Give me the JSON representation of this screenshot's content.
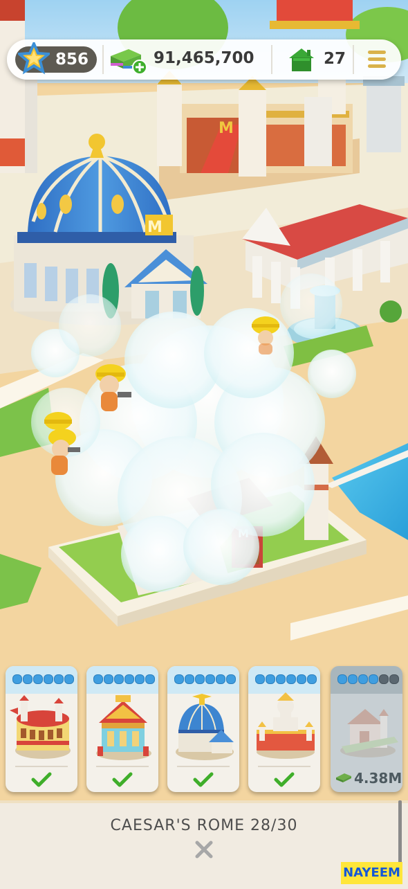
{
  "hud": {
    "level": "856",
    "cash": "91,465,700",
    "houses": "27",
    "icons": {
      "level": "star-badge-icon",
      "cash": "cash-stack-icon",
      "add_cash": "plus-icon",
      "houses": "house-icon",
      "menu": "hamburger-menu-icon"
    }
  },
  "scene": {
    "description_icons": [
      "dome-building",
      "monopoly-pavilion",
      "temple",
      "fountain",
      "construction-workers",
      "smoke-cloud",
      "house-under-construction"
    ]
  },
  "cards": [
    {
      "name": "colosseum",
      "stars_filled": 6,
      "stars_total": 6,
      "status": "done",
      "icon": "check-icon"
    },
    {
      "name": "palace",
      "stars_filled": 6,
      "stars_total": 6,
      "status": "done",
      "icon": "check-icon"
    },
    {
      "name": "domed-theatre",
      "stars_filled": 6,
      "stars_total": 6,
      "status": "done",
      "icon": "check-icon"
    },
    {
      "name": "statue-monument",
      "stars_filled": 6,
      "stars_total": 6,
      "status": "done",
      "icon": "check-icon"
    },
    {
      "name": "villa",
      "stars_filled": 4,
      "stars_total": 6,
      "status": "locked",
      "price": "4.38M",
      "icon": "cash-icon"
    }
  ],
  "bottom": {
    "title": "CAESAR'S ROME 28/30",
    "close_icon": "close-x-icon"
  },
  "watermark": "NAYEEM",
  "colors": {
    "accent_blue": "#3f9ee0",
    "check_green": "#3fae2a",
    "gold": "#d9b24a",
    "panel": "#f1ebe1"
  }
}
